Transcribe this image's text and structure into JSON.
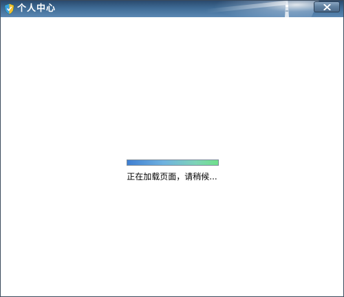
{
  "window": {
    "title": "个人中心",
    "close_label": "close"
  },
  "content": {
    "loading_text": "正在加载页面，请稍候...",
    "progress": 1.0
  },
  "colors": {
    "titlebar": "#3f6b95",
    "progress_start": "#3f7fd2",
    "progress_end": "#6fe08a"
  },
  "icons": {
    "app": "shield-icon",
    "close": "close-icon"
  }
}
